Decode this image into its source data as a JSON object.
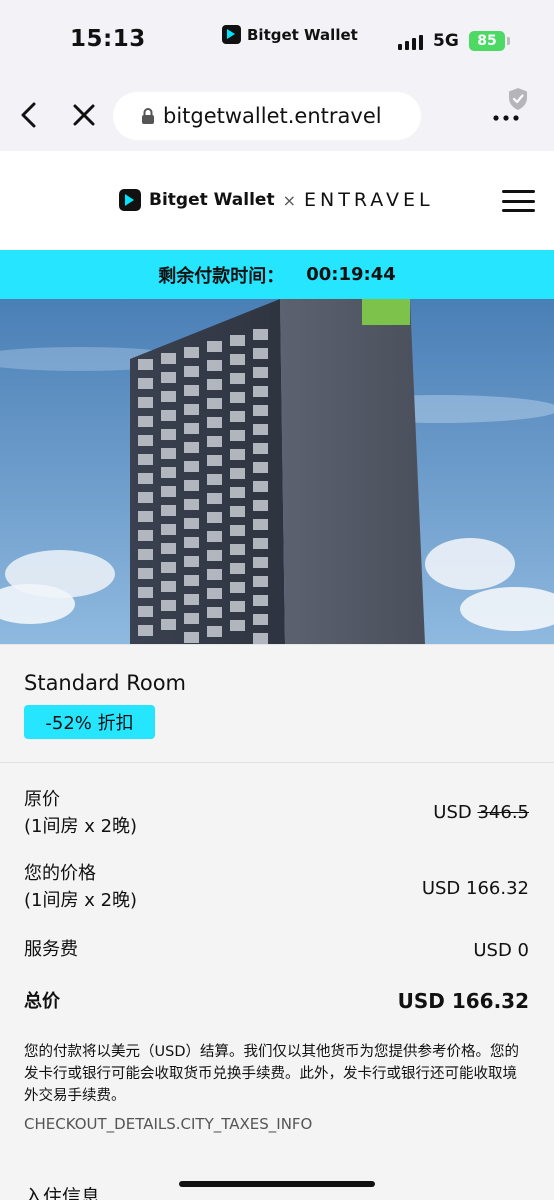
{
  "status_bar": {
    "time": "15:13",
    "app_name": "Bitget Wallet",
    "network": "5G",
    "battery": "85"
  },
  "browser": {
    "url": "bitgetwallet.entravel",
    "icons": [
      "back-icon",
      "close-icon",
      "lock-icon",
      "shield-icon",
      "more-icon"
    ]
  },
  "header": {
    "brand": "Bitget Wallet",
    "separator": "×",
    "partner": "ENTRAVEL"
  },
  "timer": {
    "label": "剩余付款时间：",
    "value": "00:19:44"
  },
  "room": {
    "title": "Standard Room",
    "discount": "-52% 折扣"
  },
  "pricing": {
    "original_label": "原价",
    "original_sub": "(1间房 x 2晚)",
    "original_currency": "USD",
    "original_value": "346.5",
    "your_price_label": "您的价格",
    "your_price_sub": "(1间房 x 2晚)",
    "your_price_value": "USD 166.32",
    "service_fee_label": "服务费",
    "service_fee_value": "USD 0",
    "total_label": "总价",
    "total_value": "USD 166.32"
  },
  "notice": "您的付款将以美元（USD）结算。我们仅以其他货币为您提供参考价格。您的发卡行或银行可能会收取货币兑换手续费。此外，发卡行或银行还可能收取境外交易手续费。",
  "taxes_info": "CHECKOUT_DETAILS.CITY_TAXES_INFO",
  "checkin_label": "入住信息",
  "colors": {
    "accent": "#26e5ff",
    "brand_dark": "#111111",
    "battery": "#4cd964",
    "card_bg": "#f4f4f4"
  }
}
